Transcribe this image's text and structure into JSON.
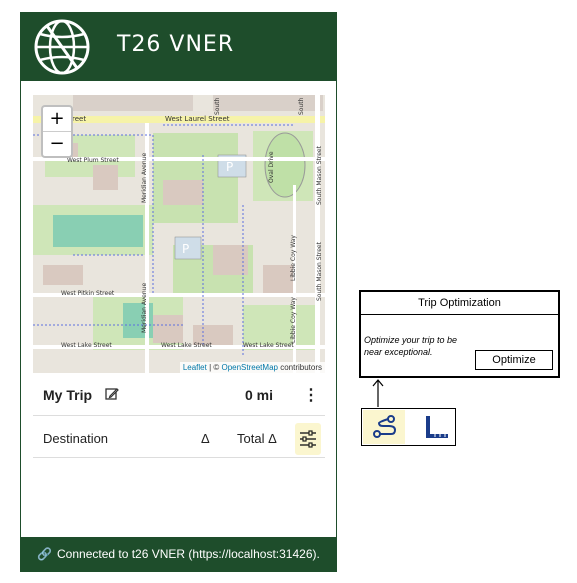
{
  "app": {
    "title": "T26 VNER"
  },
  "map": {
    "zoom_in": "+",
    "zoom_out": "−",
    "attribution_link": "Leaflet",
    "attribution_sep": " | © ",
    "attribution_osm": "OpenStreetMap",
    "attribution_tail": " contributors",
    "street_labels": [
      "Laurel Street",
      "West Laurel Street",
      "West Plum Street",
      "Meridian Avenue",
      "West Pitkin Street",
      "Meridian Avenue",
      "West Lake Street",
      "West Lake Street",
      "West Lake Street",
      "Oval Drive",
      "Libbie Coy Way",
      "Libbie Coy Way",
      "South Mason Street",
      "South Mason Street",
      "South",
      "South"
    ]
  },
  "trip": {
    "title": "My Trip",
    "distance": "0 mi"
  },
  "table": {
    "col_destination": "Destination",
    "col_delta": "Δ",
    "col_total": "Total Δ"
  },
  "footer": {
    "status": "Connected to t26 VNER  (https://localhost:31426)."
  },
  "optimization": {
    "title": "Trip Optimization",
    "text": "Optimize your trip to be near exceptional.",
    "button": "Optimize"
  },
  "icons": {
    "logo": "globe-icon",
    "edit": "pencil-icon",
    "more": "more-vertical-icon",
    "filter": "sliders-icon",
    "link": "link-icon",
    "route": "route-icon",
    "ruler": "ruler-icon"
  },
  "colors": {
    "brand": "#1e4d2b",
    "highlight": "#fbf6cf",
    "map_bg": "#e8e4dc"
  }
}
